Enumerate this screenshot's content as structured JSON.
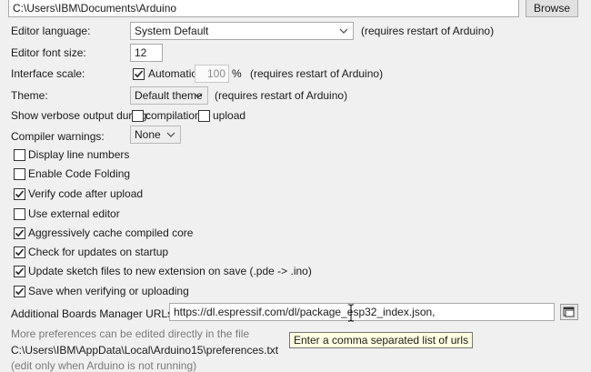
{
  "sketchbook": {
    "path": "C:\\Users\\IBM\\Documents\\Arduino",
    "browse_label": "Browse"
  },
  "editor_language": {
    "label": "Editor language:",
    "value": "System Default",
    "note": "(requires restart of Arduino)"
  },
  "editor_font_size": {
    "label": "Editor font size:",
    "value": "12"
  },
  "interface_scale": {
    "label": "Interface scale:",
    "automatic_label": "Automatic",
    "automatic_checked": true,
    "value": "100",
    "unit": "%",
    "note": "(requires restart of Arduino)"
  },
  "theme": {
    "label": "Theme:",
    "value": "Default theme",
    "note": "(requires restart of Arduino)"
  },
  "verbose": {
    "label": "Show verbose output during:",
    "compilation_label": "compilation",
    "compilation_checked": false,
    "upload_label": "upload",
    "upload_checked": false
  },
  "compiler_warnings": {
    "label": "Compiler warnings:",
    "value": "None"
  },
  "options": [
    {
      "label": "Display line numbers",
      "checked": false
    },
    {
      "label": "Enable Code Folding",
      "checked": false
    },
    {
      "label": "Verify code after upload",
      "checked": true
    },
    {
      "label": "Use external editor",
      "checked": false
    },
    {
      "label": "Aggressively cache compiled core",
      "checked": true
    },
    {
      "label": "Check for updates on startup",
      "checked": true
    },
    {
      "label": "Update sketch files to new extension on save (.pde -> .ino)",
      "checked": true
    },
    {
      "label": "Save when verifying or uploading",
      "checked": true
    }
  ],
  "boards_manager": {
    "label": "Additional Boards Manager URLs:",
    "value": "https://dl.espressif.com/dl/package_esp32_index.json,",
    "tooltip": "Enter a comma separated list of urls"
  },
  "footer": {
    "more_prefs": "More preferences can be edited directly in the file",
    "prefs_path": "C:\\Users\\IBM\\AppData\\Local\\Arduino15\\preferences.txt",
    "edit_note": "(edit only when Arduino is not running)"
  },
  "colors": {
    "background": "#f0f0f0",
    "tooltip_bg": "#ffffe1",
    "muted_text": "#7a7a7a"
  }
}
